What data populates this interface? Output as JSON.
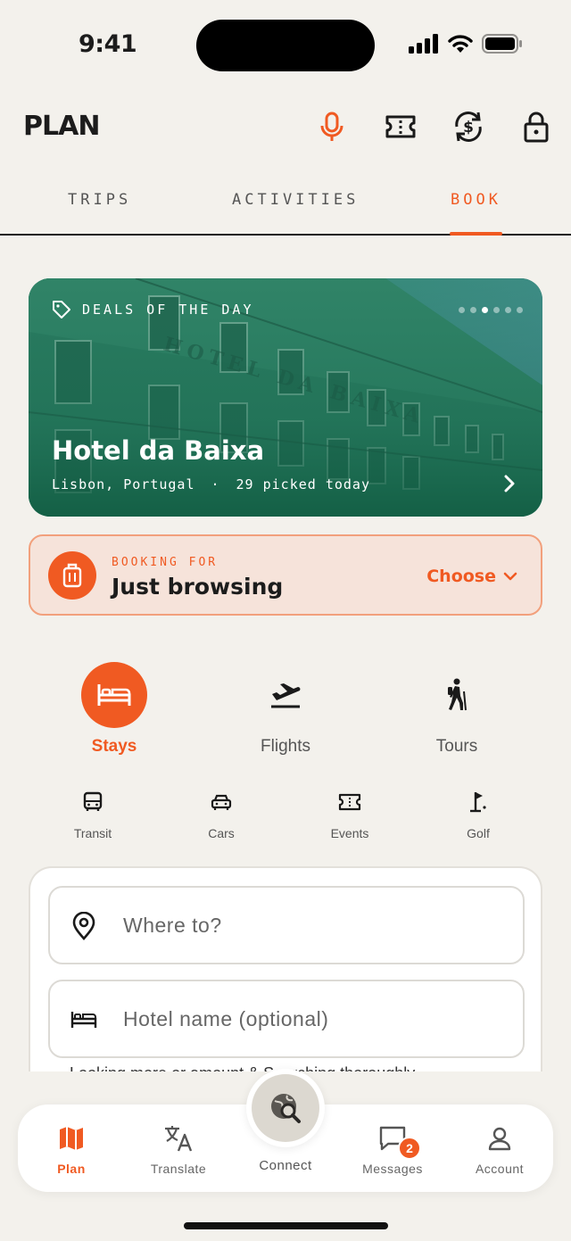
{
  "status_bar": {
    "time": "9:41"
  },
  "header": {
    "title": "PLAN",
    "icons": [
      "microphone-icon",
      "ticket-icon",
      "currency-exchange-icon",
      "lock-icon"
    ]
  },
  "tabs": [
    {
      "label": "TRIPS",
      "active": false
    },
    {
      "label": "ACTIVITIES",
      "active": false
    },
    {
      "label": "BOOK",
      "active": true
    }
  ],
  "deal": {
    "kicker": "DEALS OF THE DAY",
    "title": "Hotel da Baixa",
    "location": "Lisbon, Portugal",
    "separator": "·",
    "picked": "29 picked today",
    "carousel_active_index": 2,
    "carousel_count": 6
  },
  "booking_for": {
    "label": "BOOKING FOR",
    "value": "Just browsing",
    "action": "Choose"
  },
  "categories_main": [
    {
      "label": "Stays",
      "icon": "bed-icon",
      "active": true
    },
    {
      "label": "Flights",
      "icon": "plane-departure-icon",
      "active": false
    },
    {
      "label": "Tours",
      "icon": "hiker-icon",
      "active": false
    }
  ],
  "categories_sub": [
    {
      "label": "Transit",
      "icon": "bus-icon"
    },
    {
      "label": "Cars",
      "icon": "car-icon"
    },
    {
      "label": "Events",
      "icon": "ticket-icon"
    },
    {
      "label": "Golf",
      "icon": "golf-flag-icon"
    }
  ],
  "search": {
    "destination_placeholder": "Where to?",
    "hotel_placeholder": "Hotel name (optional)",
    "cut_text": "Looking more or amount & Searching thoroughly"
  },
  "bottom_nav": {
    "items": [
      {
        "label": "Plan",
        "icon": "map-icon",
        "active": true
      },
      {
        "label": "Translate",
        "icon": "translate-icon",
        "active": false
      },
      {
        "label": "Connect",
        "icon": "globe-search-icon",
        "active": false
      },
      {
        "label": "Messages",
        "icon": "chat-icon",
        "active": false,
        "badge": "2"
      },
      {
        "label": "Account",
        "icon": "person-icon",
        "active": false
      }
    ]
  },
  "colors": {
    "accent": "#f05a22",
    "background": "#f3f1ec",
    "booking_bg": "#f6e3da"
  }
}
